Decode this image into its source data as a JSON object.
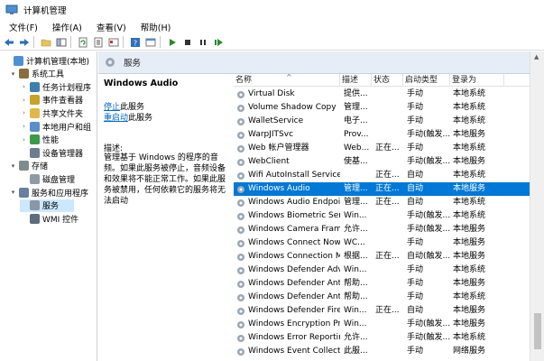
{
  "window": {
    "title": "计算机管理"
  },
  "menu": [
    "文件(F)",
    "操作(A)",
    "查看(V)",
    "帮助(H)"
  ],
  "toolbar": {
    "icons": [
      "back-arrow",
      "forward-arrow",
      "up-folder",
      "show-hide-tree",
      "refresh",
      "export-list",
      "properties",
      "help",
      "start",
      "stop",
      "pause",
      "restart"
    ]
  },
  "tree": [
    {
      "label": "计算机管理(本地)",
      "icon": "computer-icon",
      "level": 0,
      "expander": "",
      "selected": false
    },
    {
      "label": "系统工具",
      "icon": "tools-icon",
      "level": 1,
      "expander": "▾",
      "selected": false
    },
    {
      "label": "任务计划程序",
      "icon": "clock-icon",
      "level": 2,
      "expander": "›",
      "selected": false
    },
    {
      "label": "事件查看器",
      "icon": "event-icon",
      "level": 2,
      "expander": "›",
      "selected": false
    },
    {
      "label": "共享文件夹",
      "icon": "shared-folder-icon",
      "level": 2,
      "expander": "›",
      "selected": false
    },
    {
      "label": "本地用户和组",
      "icon": "users-icon",
      "level": 2,
      "expander": "›",
      "selected": false
    },
    {
      "label": "性能",
      "icon": "performance-icon",
      "level": 2,
      "expander": "›",
      "selected": false
    },
    {
      "label": "设备管理器",
      "icon": "device-icon",
      "level": 2,
      "expander": "",
      "selected": false
    },
    {
      "label": "存储",
      "icon": "storage-icon",
      "level": 1,
      "expander": "▾",
      "selected": false
    },
    {
      "label": "磁盘管理",
      "icon": "disk-icon",
      "level": 2,
      "expander": "",
      "selected": false
    },
    {
      "label": "服务和应用程序",
      "icon": "services-apps-icon",
      "level": 1,
      "expander": "▾",
      "selected": false
    },
    {
      "label": "服务",
      "icon": "gear-icon",
      "level": 2,
      "expander": "",
      "selected": true
    },
    {
      "label": "WMI 控件",
      "icon": "wmi-icon",
      "level": 2,
      "expander": "",
      "selected": false
    }
  ],
  "services_header": {
    "title": "服务"
  },
  "detail": {
    "service_name": "Windows Audio",
    "stop_link": "停止",
    "stop_suffix": "此服务",
    "restart_link": "重启动",
    "restart_suffix": "此服务",
    "desc_label": "描述:",
    "description": "管理基于 Windows 的程序的音频。如果此服务被停止，音频设备和效果将不能正常工作。如果此服务被禁用，任何依赖它的服务将无法启动"
  },
  "columns": {
    "name": "名称",
    "desc": "描述",
    "status": "状态",
    "startup": "启动类型",
    "logon": "登录为"
  },
  "sort_indicator": "^",
  "services": [
    {
      "name": "Virtual Disk",
      "desc": "提供...",
      "status": "",
      "startup": "手动",
      "logon": "本地系统",
      "selected": false
    },
    {
      "name": "Volume Shadow Copy",
      "desc": "管理...",
      "status": "",
      "startup": "手动",
      "logon": "本地系统",
      "selected": false
    },
    {
      "name": "WalletService",
      "desc": "电子...",
      "status": "",
      "startup": "手动",
      "logon": "本地系统",
      "selected": false
    },
    {
      "name": "WarpJITSvc",
      "desc": "Prov...",
      "status": "",
      "startup": "手动(触发...",
      "logon": "本地服务",
      "selected": false
    },
    {
      "name": "Web 帐户管理器",
      "desc": "Web...",
      "status": "正在...",
      "startup": "手动",
      "logon": "本地系统",
      "selected": false
    },
    {
      "name": "WebClient",
      "desc": "使基...",
      "status": "",
      "startup": "手动(触发...",
      "logon": "本地服务",
      "selected": false
    },
    {
      "name": "Wifi AutoInstall Service",
      "desc": "",
      "status": "正在...",
      "startup": "自动",
      "logon": "本地系统",
      "selected": false
    },
    {
      "name": "Windows Audio",
      "desc": "管理...",
      "status": "正在...",
      "startup": "自动",
      "logon": "本地服务",
      "selected": true
    },
    {
      "name": "Windows Audio Endpoint...",
      "desc": "管理...",
      "status": "正在...",
      "startup": "自动",
      "logon": "本地系统",
      "selected": false
    },
    {
      "name": "Windows Biometric Servi...",
      "desc": "Win...",
      "status": "",
      "startup": "手动(触发...",
      "logon": "本地系统",
      "selected": false
    },
    {
      "name": "Windows Camera Frame ...",
      "desc": "允许...",
      "status": "",
      "startup": "手动(触发...",
      "logon": "本地服务",
      "selected": false
    },
    {
      "name": "Windows Connect Now -...",
      "desc": "WC...",
      "status": "",
      "startup": "手动",
      "logon": "本地服务",
      "selected": false
    },
    {
      "name": "Windows Connection Ma...",
      "desc": "根据...",
      "status": "正在...",
      "startup": "自动(触发...",
      "logon": "本地服务",
      "selected": false
    },
    {
      "name": "Windows Defender Adva...",
      "desc": "Win...",
      "status": "",
      "startup": "手动",
      "logon": "本地系统",
      "selected": false
    },
    {
      "name": "Windows Defender Antivi...",
      "desc": "帮助...",
      "status": "",
      "startup": "手动",
      "logon": "本地服务",
      "selected": false
    },
    {
      "name": "Windows Defender Antivi...",
      "desc": "帮助...",
      "status": "",
      "startup": "手动",
      "logon": "本地系统",
      "selected": false
    },
    {
      "name": "Windows Defender Firew...",
      "desc": "Win...",
      "status": "正在...",
      "startup": "自动",
      "logon": "本地服务",
      "selected": false
    },
    {
      "name": "Windows Encryption Pro...",
      "desc": "Win...",
      "status": "",
      "startup": "手动(触发...",
      "logon": "本地服务",
      "selected": false
    },
    {
      "name": "Windows Error Reportin...",
      "desc": "允许...",
      "status": "",
      "startup": "手动(触发...",
      "logon": "本地系统",
      "selected": false
    },
    {
      "name": "Windows Event Collector",
      "desc": "此服...",
      "status": "",
      "startup": "手动",
      "logon": "网络服务",
      "selected": false
    }
  ],
  "colors": {
    "selection": "#0078d7",
    "tree_selection": "#cce8ff",
    "link": "#0066cc",
    "header_bg": "#e6edf6"
  }
}
